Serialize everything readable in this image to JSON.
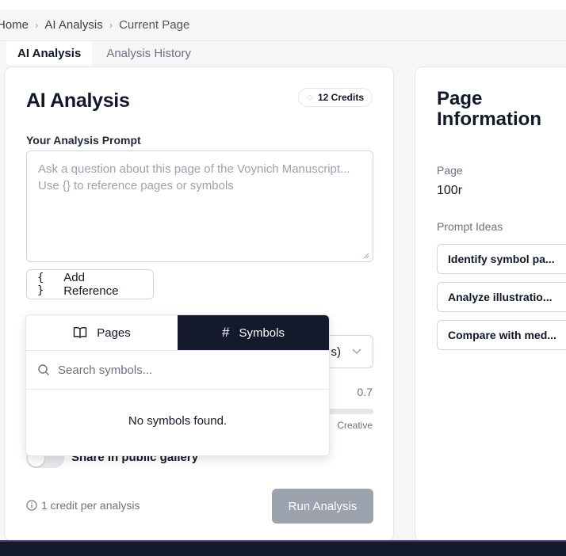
{
  "breadcrumb": {
    "home": "Home",
    "section": "AI Analysis",
    "current": "Current Page",
    "separator": "›"
  },
  "tabs": [
    {
      "label": "AI Analysis",
      "active": true
    },
    {
      "label": "Analysis History",
      "active": false
    }
  ],
  "main": {
    "title": "AI Analysis",
    "credits": "12 Credits",
    "prompt_label": "Your Analysis Prompt",
    "prompt_placeholder": "Ask a question about this page of the Voynich Manuscript... Use {} to reference pages or symbols",
    "add_reference": {
      "icon": "{ }",
      "label": "Add Reference"
    },
    "select_fragment": "s)",
    "temperature_value": "0.7",
    "temperature_right_label": "Creative",
    "share_label": "Share in public gallery",
    "share_enabled": false,
    "credit_note": "1 credit per analysis",
    "run_button": "Run Analysis"
  },
  "popover": {
    "tabs": [
      {
        "label": "Pages",
        "icon": "book-icon",
        "active": false
      },
      {
        "label": "Symbols",
        "icon": "hash-icon",
        "active": true
      }
    ],
    "search_placeholder": "Search symbols...",
    "empty_message": "No symbols found."
  },
  "side": {
    "title": "Page Information",
    "page_label": "Page",
    "page_value": "100r",
    "ideas_label": "Prompt Ideas",
    "ideas": [
      "Identify symbol pa...",
      "Analyze illustratio...",
      "Compare with med..."
    ]
  },
  "colors": {
    "accent_dark": "#141a2b",
    "run_button_disabled": "#9ca3af",
    "page_bg": "#f6f6f7"
  }
}
